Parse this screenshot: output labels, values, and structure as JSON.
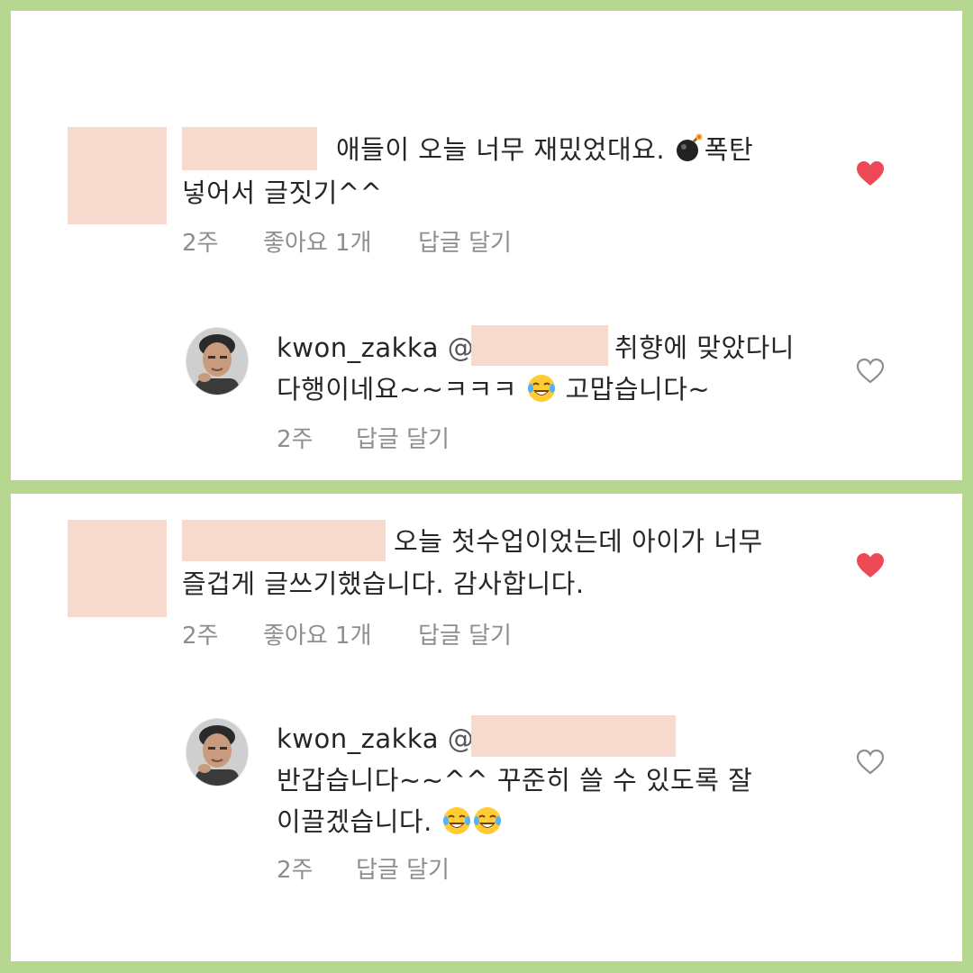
{
  "colors": {
    "border": "#b5d78f",
    "redaction": "#f7d9ce",
    "liked_heart": "#ed4956",
    "meta_text": "#8e8e8e"
  },
  "panels": [
    {
      "comment": {
        "line1": "애들이 오늘 너무 재밌었대요.",
        "line1_after_emoji": "폭탄",
        "emoji": "bomb-emoji",
        "line2": "넣어서 글짓기^^",
        "time": "2주",
        "likes": "좋아요 1개",
        "reply": "답글 달기",
        "liked": true
      },
      "reply": {
        "username": "kwon_zakka",
        "at": "@",
        "line1": "취향에 맞았다니",
        "line2": "다행이네요~~ㅋㅋㅋ",
        "line2_after_emoji": "고맙습니다~",
        "emoji": "tears-of-joy-emoji",
        "time": "2주",
        "reply": "답글 달기",
        "liked": false
      }
    },
    {
      "comment": {
        "line1": "오늘 첫수업이었는데 아이가 너무",
        "line2": "즐겁게 글쓰기했습니다. 감사합니다.",
        "time": "2주",
        "likes": "좋아요 1개",
        "reply": "답글 달기",
        "liked": true
      },
      "reply": {
        "username": "kwon_zakka",
        "at": "@",
        "line1": "",
        "line2": "반갑습니다~~^^ 꾸준히 쓸 수 있도록 잘",
        "line3": "이끌겠습니다.",
        "emoji": "tears-of-joy-emoji",
        "time": "2주",
        "reply": "답글 달기",
        "liked": false
      }
    }
  ]
}
